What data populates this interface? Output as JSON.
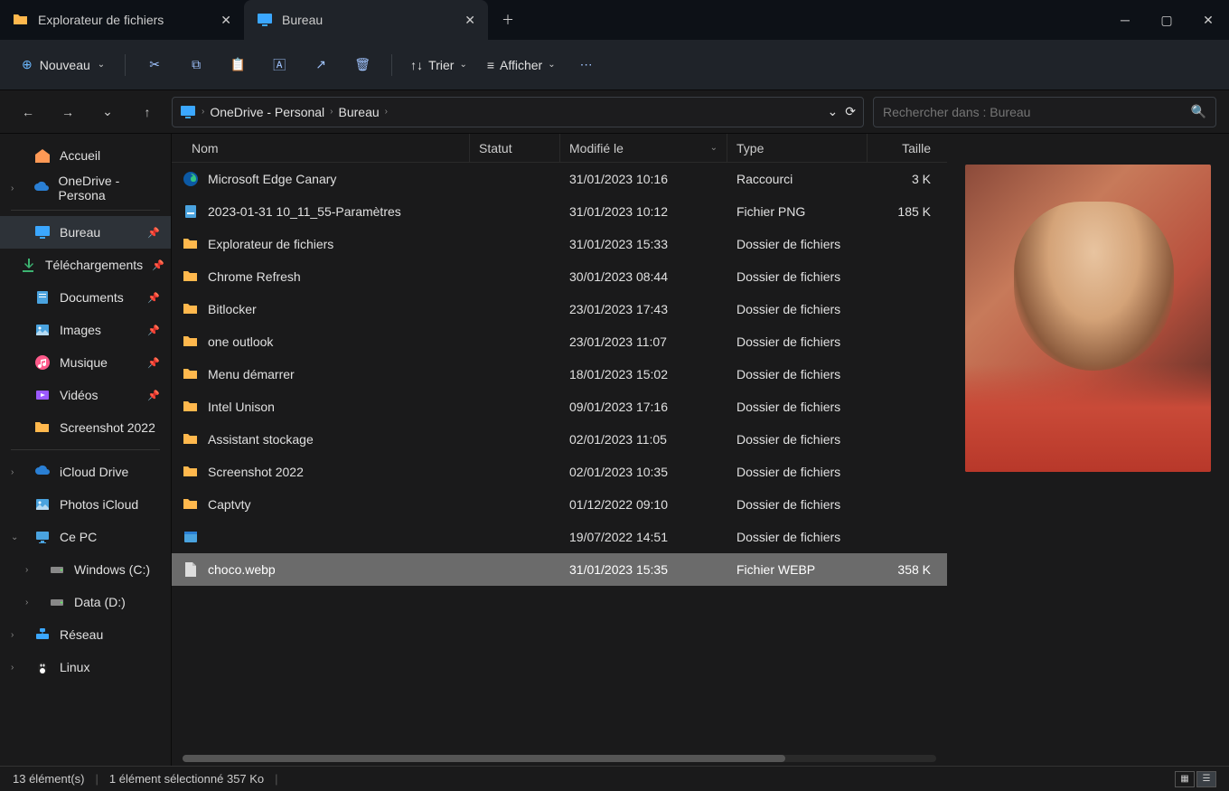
{
  "tabs": [
    {
      "label": "Explorateur de fichiers",
      "active": false
    },
    {
      "label": "Bureau",
      "active": true
    }
  ],
  "toolbar": {
    "new_label": "Nouveau",
    "sort_label": "Trier",
    "view_label": "Afficher"
  },
  "breadcrumb": {
    "segments": [
      "OneDrive - Personal",
      "Bureau"
    ]
  },
  "search": {
    "placeholder": "Rechercher dans : Bureau"
  },
  "sidebar": {
    "home": "Accueil",
    "onedrive": "OneDrive - Persona",
    "quick": [
      {
        "label": "Bureau",
        "icon": "desktop",
        "selected": true,
        "pin": true
      },
      {
        "label": "Téléchargements",
        "icon": "down",
        "pin": true
      },
      {
        "label": "Documents",
        "icon": "doc-side",
        "pin": true
      },
      {
        "label": "Images",
        "icon": "img-side",
        "pin": true
      },
      {
        "label": "Musique",
        "icon": "music",
        "pin": true
      },
      {
        "label": "Vidéos",
        "icon": "video",
        "pin": true
      },
      {
        "label": "Screenshot 2022",
        "icon": "folder",
        "pin": false
      }
    ],
    "nav": [
      {
        "label": "iCloud Drive",
        "icon": "cloud",
        "exp": true
      },
      {
        "label": "Photos iCloud",
        "icon": "img-side",
        "exp": false
      },
      {
        "label": "Ce PC",
        "icon": "pc",
        "exp": true,
        "open": true
      },
      {
        "label": "Windows (C:)",
        "icon": "drive",
        "exp": true,
        "indent": true
      },
      {
        "label": "Data (D:)",
        "icon": "drive",
        "exp": true,
        "indent": true
      },
      {
        "label": "Réseau",
        "icon": "net",
        "exp": true
      },
      {
        "label": "Linux",
        "icon": "tux",
        "exp": true
      }
    ]
  },
  "columns": {
    "name": "Nom",
    "status": "Statut",
    "modified": "Modifié le",
    "type": "Type",
    "size": "Taille"
  },
  "files": [
    {
      "name": "Microsoft Edge Canary",
      "icon": "edge",
      "mod": "31/01/2023 10:16",
      "type": "Raccourci",
      "size": "3 K"
    },
    {
      "name": "2023-01-31 10_11_55-Paramètres",
      "icon": "png",
      "mod": "31/01/2023 10:12",
      "type": "Fichier PNG",
      "size": "185 K"
    },
    {
      "name": "Explorateur de fichiers",
      "icon": "folder",
      "mod": "31/01/2023 15:33",
      "type": "Dossier de fichiers",
      "size": ""
    },
    {
      "name": "Chrome Refresh",
      "icon": "folder",
      "mod": "30/01/2023 08:44",
      "type": "Dossier de fichiers",
      "size": ""
    },
    {
      "name": "Bitlocker",
      "icon": "folder",
      "mod": "23/01/2023 17:43",
      "type": "Dossier de fichiers",
      "size": ""
    },
    {
      "name": "one outlook",
      "icon": "folder",
      "mod": "23/01/2023 11:07",
      "type": "Dossier de fichiers",
      "size": ""
    },
    {
      "name": "Menu démarrer",
      "icon": "folder",
      "mod": "18/01/2023 15:02",
      "type": "Dossier de fichiers",
      "size": ""
    },
    {
      "name": "Intel Unison",
      "icon": "folder",
      "mod": "09/01/2023 17:16",
      "type": "Dossier de fichiers",
      "size": ""
    },
    {
      "name": "Assistant stockage",
      "icon": "folder",
      "mod": "02/01/2023 11:05",
      "type": "Dossier de fichiers",
      "size": ""
    },
    {
      "name": "Screenshot 2022",
      "icon": "folder",
      "mod": "02/01/2023 10:35",
      "type": "Dossier de fichiers",
      "size": ""
    },
    {
      "name": "Captvty",
      "icon": "folder",
      "mod": "01/12/2022 09:10",
      "type": "Dossier de fichiers",
      "size": ""
    },
    {
      "name": "",
      "icon": "app",
      "mod": "19/07/2022 14:51",
      "type": "Dossier de fichiers",
      "size": ""
    },
    {
      "name": "choco.webp",
      "icon": "file",
      "mod": "31/01/2023 15:35",
      "type": "Fichier WEBP",
      "size": "358 K",
      "selected": true
    }
  ],
  "status": {
    "count": "13 élément(s)",
    "selection": "1 élément sélectionné  357 Ko"
  }
}
